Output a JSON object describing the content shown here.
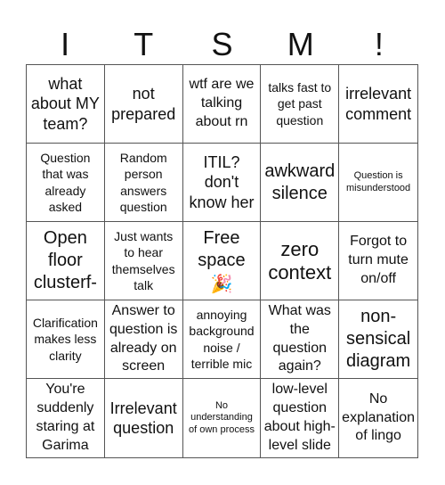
{
  "header": {
    "letters": [
      "I",
      "T",
      "S",
      "M",
      "!"
    ]
  },
  "board": {
    "cells": [
      {
        "text": "what about MY team?"
      },
      {
        "text": "not prepared"
      },
      {
        "text": "wtf are we talking about rn"
      },
      {
        "text": "talks fast to get past question"
      },
      {
        "text": "irrelevant comment"
      },
      {
        "text": "Question that was already asked"
      },
      {
        "text": "Random person answers question"
      },
      {
        "text": "ITIL? don't know her"
      },
      {
        "text": "awkward silence"
      },
      {
        "text": "Question is misunderstood"
      },
      {
        "text": "Open floor clusterf-"
      },
      {
        "text": "Just wants to hear themselves talk"
      },
      {
        "text": "Free space",
        "icon": "party-popper-icon",
        "icon_glyph": "🎉"
      },
      {
        "text": "zero context"
      },
      {
        "text": "Forgot to turn mute on/off"
      },
      {
        "text": "Clarification makes less clarity"
      },
      {
        "text": "Answer to question is already on screen"
      },
      {
        "text": "annoying background noise / terrible mic"
      },
      {
        "text": "What was the question again?"
      },
      {
        "text": "non-sensical diagram"
      },
      {
        "text": "You're suddenly staring at Garima"
      },
      {
        "text": "Irrelevant question"
      },
      {
        "text": "No understanding of own process"
      },
      {
        "text": "low-level question about high-level slide"
      },
      {
        "text": "No explanation of lingo"
      }
    ]
  },
  "colors": {
    "grid_line": "#555555",
    "text": "#111111",
    "background": "#ffffff"
  }
}
